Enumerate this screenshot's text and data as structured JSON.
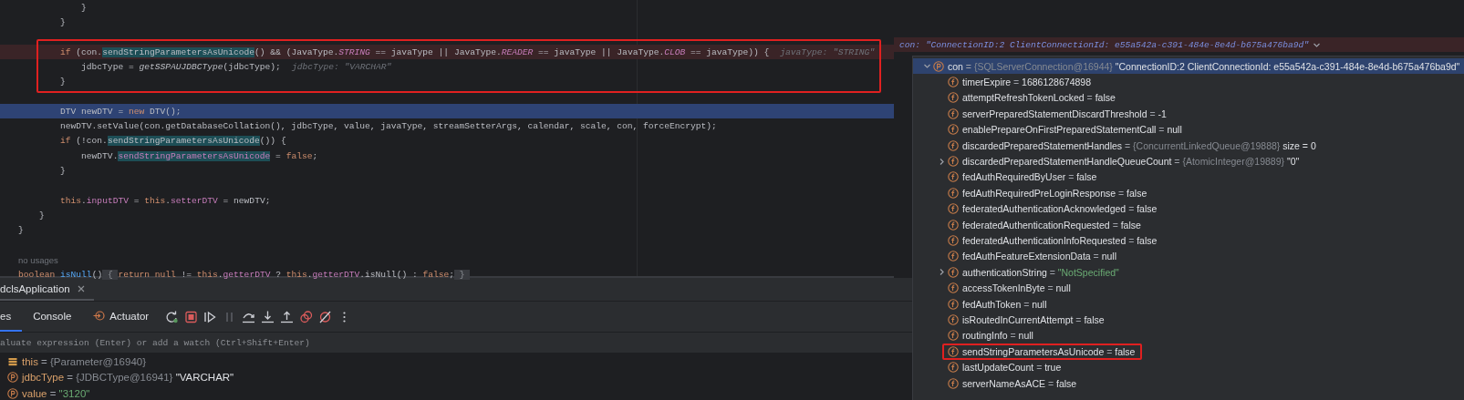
{
  "editor": {
    "blocks": [
      {
        "boxed": false,
        "lines": [
          {
            "kind": "code",
            "tokens": [
              {
                "kind": "plain",
                "text": "            }"
              }
            ]
          },
          {
            "kind": "code",
            "tokens": [
              {
                "kind": "plain",
                "text": "        }"
              }
            ]
          },
          {
            "kind": "blank"
          }
        ]
      },
      {
        "boxed": true,
        "lines": [
          {
            "kind": "breakpoint",
            "hint": "javaType: \"STRING\"",
            "tokens": [
              {
                "kind": "keyword",
                "text": "        if"
              },
              {
                "kind": "plain",
                "text": " (con."
              },
              {
                "kind": "usage",
                "text": "sendStringParametersAsUnicode"
              },
              {
                "kind": "plain",
                "text": "() && (JavaType."
              },
              {
                "kind": "static",
                "text": "STRING"
              },
              {
                "kind": "plain",
                "text": " == javaType || JavaType."
              },
              {
                "kind": "static",
                "text": "READER"
              },
              {
                "kind": "plain",
                "text": " == javaType || JavaType."
              },
              {
                "kind": "static",
                "text": "CLOB"
              },
              {
                "kind": "plain",
                "text": " == javaType)) {"
              }
            ]
          },
          {
            "kind": "code",
            "hint": "jdbcType: \"VARCHAR\"",
            "tokens": [
              {
                "kind": "plain",
                "text": "            jdbcType = "
              },
              {
                "kind": "italic",
                "text": "getSSPAUJDBCType"
              },
              {
                "kind": "plain",
                "text": "(jdbcType);"
              }
            ]
          },
          {
            "kind": "code",
            "tokens": [
              {
                "kind": "plain",
                "text": "        }"
              }
            ]
          }
        ]
      },
      {
        "boxed": false,
        "lines": [
          {
            "kind": "blank"
          },
          {
            "kind": "current",
            "tokens": [
              {
                "kind": "plain",
                "text": "        DTV newDTV = "
              },
              {
                "kind": "keyword",
                "text": "new"
              },
              {
                "kind": "plain",
                "text": " DTV();"
              }
            ]
          },
          {
            "kind": "code",
            "tokens": [
              {
                "kind": "plain",
                "text": "        newDTV.setValue(con.getDatabaseCollation(), jdbcType, value, javaType, streamSetterArgs, calendar, scale, con, forceEncrypt);"
              }
            ]
          },
          {
            "kind": "code",
            "tokens": [
              {
                "kind": "keyword",
                "text": "        if"
              },
              {
                "kind": "plain",
                "text": " (!con."
              },
              {
                "kind": "usage",
                "text": "sendStringParametersAsUnicode"
              },
              {
                "kind": "plain",
                "text": "()) {"
              }
            ]
          },
          {
            "kind": "code",
            "tokens": [
              {
                "kind": "plain",
                "text": "            newDTV."
              },
              {
                "kind": "usage_field",
                "text": "sendStringParametersAsUnicode"
              },
              {
                "kind": "plain",
                "text": " = "
              },
              {
                "kind": "keyword",
                "text": "false"
              },
              {
                "kind": "plain",
                "text": ";"
              }
            ]
          },
          {
            "kind": "code",
            "tokens": [
              {
                "kind": "plain",
                "text": "        }"
              }
            ]
          },
          {
            "kind": "blank"
          },
          {
            "kind": "code",
            "tokens": [
              {
                "kind": "keyword",
                "text": "        this"
              },
              {
                "kind": "plain",
                "text": "."
              },
              {
                "kind": "field",
                "text": "inputDTV"
              },
              {
                "kind": "plain",
                "text": " = "
              },
              {
                "kind": "keyword",
                "text": "this"
              },
              {
                "kind": "plain",
                "text": "."
              },
              {
                "kind": "field",
                "text": "setterDTV"
              },
              {
                "kind": "plain",
                "text": " = newDTV;"
              }
            ]
          },
          {
            "kind": "code",
            "tokens": [
              {
                "kind": "plain",
                "text": "    }"
              }
            ]
          },
          {
            "kind": "code",
            "tokens": [
              {
                "kind": "plain",
                "text": "}"
              }
            ]
          },
          {
            "kind": "blank"
          },
          {
            "kind": "note",
            "text": "no usages"
          },
          {
            "kind": "code",
            "tokens": [
              {
                "kind": "keyword",
                "text": "boolean"
              },
              {
                "kind": "decl",
                "text": " isNull"
              },
              {
                "kind": "plain",
                "text": "()"
              },
              {
                "kind": "fold",
                "text": " { "
              },
              {
                "kind": "keyword",
                "text": "return null"
              },
              {
                "kind": "plain",
                "text": " != "
              },
              {
                "kind": "keyword",
                "text": "this"
              },
              {
                "kind": "plain",
                "text": "."
              },
              {
                "kind": "field",
                "text": "getterDTV"
              },
              {
                "kind": "plain",
                "text": " ? "
              },
              {
                "kind": "keyword",
                "text": "this"
              },
              {
                "kind": "plain",
                "text": "."
              },
              {
                "kind": "field",
                "text": "getterDTV"
              },
              {
                "kind": "plain",
                "text": ".isNull() : "
              },
              {
                "kind": "keyword",
                "text": "false"
              },
              {
                "kind": "plain",
                "text": ";"
              },
              {
                "kind": "fold",
                "text": " } "
              }
            ]
          }
        ]
      }
    ]
  },
  "inline_value_popup": {
    "text": "con: \"ConnectionID:2 ClientConnectionId: e55a542a-c391-484e-8e4d-b675a476ba9d\""
  },
  "variables_popup": {
    "rows": [
      {
        "kind": "parameter",
        "name": "con",
        "op": "=",
        "ref": "{SQLServerConnection@16944}",
        "value": "\"ConnectionID:2 ClientConnectionId: e55a542a-c391-484e-8e4d-b675a476ba9d\"",
        "string": false,
        "expanded": true,
        "selected": true,
        "boxed": false,
        "children": [
          {
            "kind": "field",
            "name": "timerExpire",
            "op": "=",
            "value": "1686128674898",
            "string": false,
            "selected": false,
            "boxed": false
          },
          {
            "kind": "field",
            "name": "attemptRefreshTokenLocked",
            "op": "=",
            "value": "false",
            "string": false,
            "selected": false,
            "boxed": false
          },
          {
            "kind": "field",
            "name": "serverPreparedStatementDiscardThreshold",
            "op": "=",
            "value": "-1",
            "string": false,
            "selected": false,
            "boxed": false
          },
          {
            "kind": "field",
            "name": "enablePrepareOnFirstPreparedStatementCall",
            "op": "=",
            "value": "null",
            "string": false,
            "selected": false,
            "boxed": false
          },
          {
            "kind": "field",
            "name": "discardedPreparedStatementHandles",
            "op": "=",
            "ref": "{ConcurrentLinkedQueue@19888}",
            "value": "size = 0",
            "string": false,
            "selected": false,
            "boxed": false
          },
          {
            "kind": "field",
            "name": "discardedPreparedStatementHandleQueueCount",
            "op": "=",
            "ref": "{AtomicInteger@19889}",
            "value": "\"0\"",
            "string": false,
            "expanded": false,
            "selected": false,
            "boxed": false
          },
          {
            "kind": "field",
            "name": "fedAuthRequiredByUser",
            "op": "=",
            "value": "false",
            "string": false,
            "selected": false,
            "boxed": false
          },
          {
            "kind": "field",
            "name": "fedAuthRequiredPreLoginResponse",
            "op": "=",
            "value": "false",
            "string": false,
            "selected": false,
            "boxed": false
          },
          {
            "kind": "field",
            "name": "federatedAuthenticationAcknowledged",
            "op": "=",
            "value": "false",
            "string": false,
            "selected": false,
            "boxed": false
          },
          {
            "kind": "field",
            "name": "federatedAuthenticationRequested",
            "op": "=",
            "value": "false",
            "string": false,
            "selected": false,
            "boxed": false
          },
          {
            "kind": "field",
            "name": "federatedAuthenticationInfoRequested",
            "op": "=",
            "value": "false",
            "string": false,
            "selected": false,
            "boxed": false
          },
          {
            "kind": "field",
            "name": "fedAuthFeatureExtensionData",
            "op": "=",
            "value": "null",
            "string": false,
            "selected": false,
            "boxed": false
          },
          {
            "kind": "field",
            "name": "authenticationString",
            "op": "=",
            "value": "\"NotSpecified\"",
            "string": true,
            "expanded": false,
            "selected": false,
            "boxed": false
          },
          {
            "kind": "field",
            "name": "accessTokenInByte",
            "op": "=",
            "value": "null",
            "string": false,
            "selected": false,
            "boxed": false
          },
          {
            "kind": "field",
            "name": "fedAuthToken",
            "op": "=",
            "value": "null",
            "string": false,
            "selected": false,
            "boxed": false
          },
          {
            "kind": "field",
            "name": "isRoutedInCurrentAttempt",
            "op": "=",
            "value": "false",
            "string": false,
            "selected": false,
            "boxed": false
          },
          {
            "kind": "field",
            "name": "routingInfo",
            "op": "=",
            "value": "null",
            "string": false,
            "selected": false,
            "boxed": false
          },
          {
            "kind": "field",
            "name": "sendStringParametersAsUnicode",
            "op": "=",
            "value": "false",
            "string": false,
            "selected": false,
            "boxed": true
          },
          {
            "kind": "field",
            "name": "lastUpdateCount",
            "op": "=",
            "value": "true",
            "string": false,
            "selected": false,
            "boxed": false
          },
          {
            "kind": "field",
            "name": "serverNameAsACE",
            "op": "=",
            "value": "false",
            "string": false,
            "selected": false,
            "boxed": false
          }
        ]
      }
    ]
  },
  "debug_panel": {
    "session_tab": {
      "label": "dclsApplication"
    },
    "tabs": [
      {
        "label": "es",
        "kind": "plain",
        "selected": true
      },
      {
        "label": "Console",
        "kind": "plain",
        "selected": false
      },
      {
        "label": "Actuator",
        "kind": "actuator",
        "selected": false
      }
    ],
    "toolbar": [
      {
        "kind": "rerun",
        "disabled": false
      },
      {
        "kind": "stop",
        "disabled": false
      },
      {
        "kind": "resume",
        "disabled": false
      },
      {
        "kind": "pause",
        "disabled": true
      },
      {
        "kind": "step_over",
        "disabled": false
      },
      {
        "kind": "step_into",
        "disabled": false
      },
      {
        "kind": "step_out",
        "disabled": false
      },
      {
        "kind": "breakpoints",
        "disabled": false
      },
      {
        "kind": "mute",
        "disabled": false
      },
      {
        "kind": "more",
        "disabled": false
      }
    ],
    "eval_field": {
      "placeholder": "aluate expression (Enter) or add a watch (Ctrl+Shift+Enter)"
    },
    "variables": [
      {
        "kind": "object",
        "name": "this",
        "op": "=",
        "ref": "{Parameter@16940}"
      },
      {
        "kind": "parameter",
        "name": "jdbcType",
        "op": "=",
        "ref": "{JDBCType@16941}",
        "value": "\"VARCHAR\"",
        "string": false
      },
      {
        "kind": "parameter",
        "name": "value",
        "op": "=",
        "value": "\"3120\"",
        "string": true
      }
    ]
  }
}
